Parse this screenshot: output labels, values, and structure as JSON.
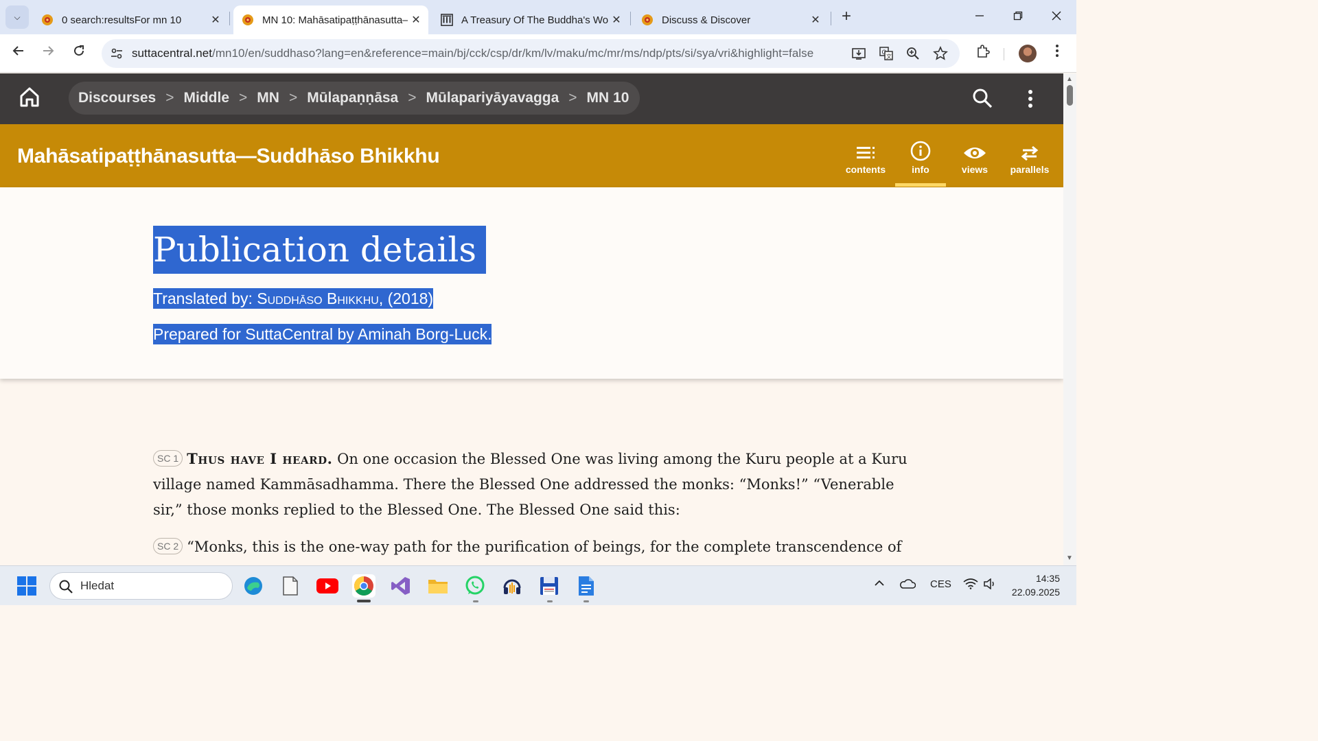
{
  "browser": {
    "tabs": [
      {
        "title": "0 search:resultsFor mn 10",
        "active": false,
        "favicon": "suttacentral-icon"
      },
      {
        "title": "MN 10: Mahāsatipaṭṭhānasutta—",
        "active": true,
        "favicon": "suttacentral-icon"
      },
      {
        "title": "A Treasury Of The Buddha's Wo",
        "active": false,
        "favicon": "library-icon"
      },
      {
        "title": "Discuss & Discover",
        "active": false,
        "favicon": "suttacentral-icon"
      }
    ],
    "close_glyph": "✕",
    "new_tab_glyph": "+",
    "url_host": "suttacentral.net",
    "url_path": "/mn10/en/suddhaso?lang=en&reference=main/bj/cck/csp/dr/km/lv/maku/mc/mr/ms/ndp/pts/si/sya/vri&highlight=false"
  },
  "site": {
    "breadcrumbs": [
      "Discourses",
      "Middle",
      "MN",
      "Mūlapaṇṇāsa",
      "Mūlapariyāyavagga",
      "MN 10"
    ],
    "crumb_separator": ">",
    "doc_title": "Mahāsatipaṭṭhānasutta—Suddhāso Bhikkhu",
    "toolbar": [
      {
        "label": "contents",
        "icon": "contents-icon",
        "active": false
      },
      {
        "label": "info",
        "icon": "info-icon",
        "active": true
      },
      {
        "label": "views",
        "icon": "eye-icon",
        "active": false
      },
      {
        "label": "parallels",
        "icon": "parallels-icon",
        "active": false
      }
    ],
    "accent_color": "#c68a07"
  },
  "info_panel": {
    "title": "Publication details",
    "translated_prefix": "Translated by: ",
    "translator": "Suddhāso Bhikkhu",
    "translated_suffix": ", (2018)",
    "prepared": "Prepared for SuttaCentral by Aminah Borg-Luck."
  },
  "text": {
    "paragraphs": [
      {
        "ref": "SC 1",
        "lead": "Thus have I heard.",
        "body": " On one occasion the Blessed One was living among the Kuru people at a Kuru village named Kammāsadhamma. There the Blessed One addressed the monks: “Monks!” “Venerable sir,” those monks replied to the Blessed One. The Blessed One said this:"
      },
      {
        "ref": "SC 2",
        "lead": "",
        "body": "“Monks, this is the one-way path for the purification of beings, for the complete transcendence of"
      }
    ]
  },
  "taskbar": {
    "search_placeholder": "Hledat",
    "apps": [
      "edge-icon",
      "notepad-icon",
      "youtube-icon",
      "chrome-icon",
      "visual-studio-icon",
      "file-explorer-icon",
      "whatsapp-icon",
      "audacity-icon",
      "save-app-icon",
      "docs-icon"
    ],
    "language": "CES",
    "time": "14:35",
    "date": "22.09.2025"
  }
}
